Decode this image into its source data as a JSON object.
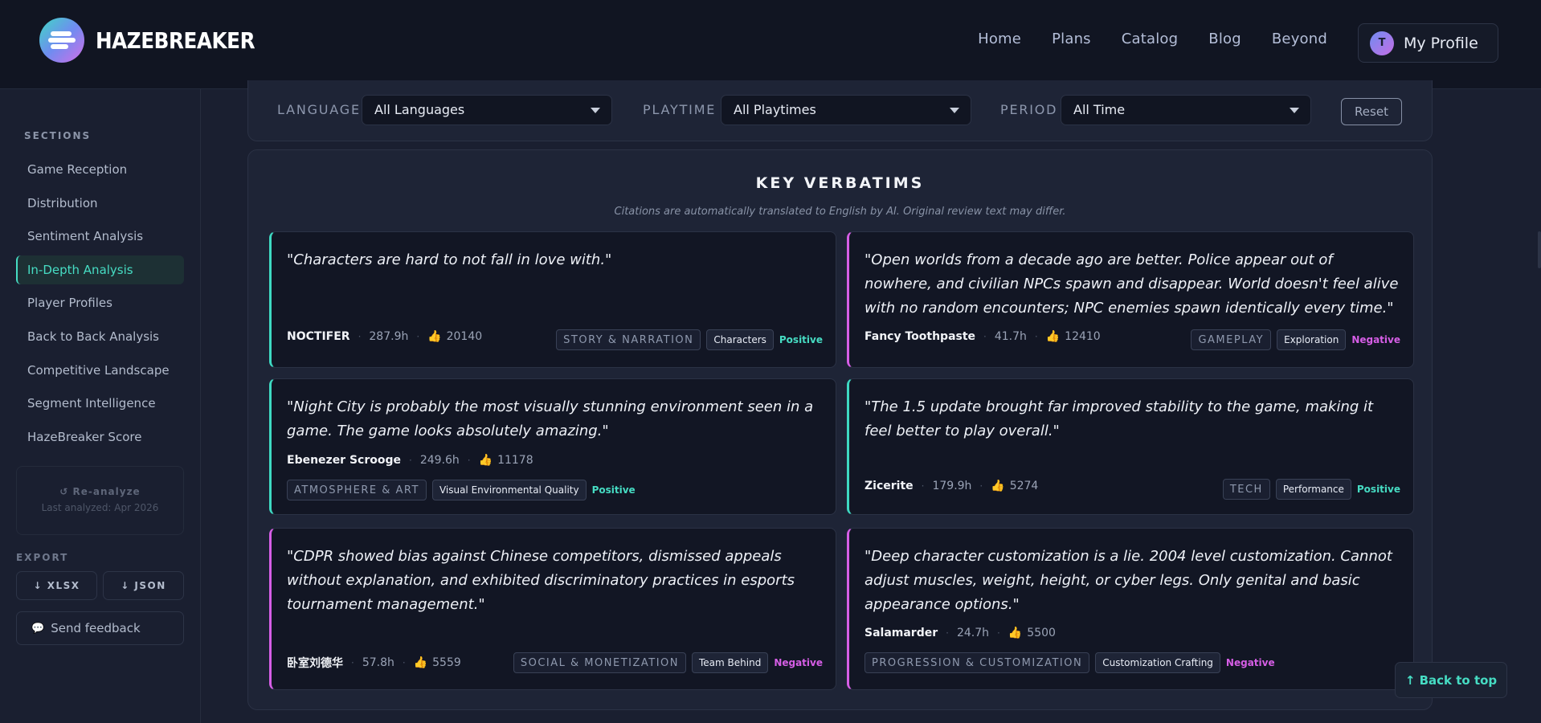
{
  "header": {
    "brand": "HAZEBREAKER",
    "nav": [
      "Home",
      "Plans",
      "Catalog",
      "Blog",
      "Beyond"
    ],
    "profile": {
      "initial": "T",
      "label": "My Profile"
    }
  },
  "sidebar": {
    "sections_title": "SECTIONS",
    "items": [
      {
        "label": "Game Reception",
        "active": false
      },
      {
        "label": "Distribution",
        "active": false
      },
      {
        "label": "Sentiment Analysis",
        "active": false
      },
      {
        "label": "In-Depth Analysis",
        "active": true
      },
      {
        "label": "Player Profiles",
        "active": false
      },
      {
        "label": "Back to Back Analysis",
        "active": false
      },
      {
        "label": "Competitive Landscape",
        "active": false
      },
      {
        "label": "Segment Intelligence",
        "active": false
      },
      {
        "label": "HazeBreaker Score",
        "active": false
      }
    ],
    "reanalyze": {
      "label": "↺ Re-analyze",
      "last": "Last analyzed: Apr 2026"
    },
    "export_title": "EXPORT",
    "export_xlsx": "↓ XLSX",
    "export_json": "↓ JSON",
    "feedback": "Send feedback"
  },
  "filters": {
    "language": {
      "label": "LANGUAGE",
      "value": "All Languages"
    },
    "playtime": {
      "label": "PLAYTIME",
      "value": "All Playtimes"
    },
    "period": {
      "label": "PERIOD",
      "value": "All Time"
    },
    "reset": "Reset"
  },
  "panel": {
    "title": "KEY VERBATIMS",
    "subtitle": "Citations are automatically translated to English by AI. Original review text may differ."
  },
  "cards": [
    {
      "quote": "\"Characters are hard to not fall in love with.\"",
      "author": "NOCTIFER",
      "hours": "287.9h",
      "likes": "20140",
      "category": "STORY & NARRATION",
      "sub": "Characters",
      "sentiment": "Positive"
    },
    {
      "quote": "\"Open worlds from a decade ago are better. Police appear out of nowhere, and civilian NPCs spawn and disappear. World doesn't feel alive with no random encounters; NPC enemies spawn identically every time.\"",
      "author": "Fancy Toothpaste",
      "hours": "41.7h",
      "likes": "12410",
      "category": "GAMEPLAY",
      "sub": "Exploration",
      "sentiment": "Negative"
    },
    {
      "quote": "\"Night City is probably the most visually stunning environment seen in a game. The game looks absolutely amazing.\"",
      "author": "Ebenezer Scrooge",
      "hours": "249.6h",
      "likes": "11178",
      "category": "ATMOSPHERE & ART",
      "sub": "Visual Environmental Quality",
      "sentiment": "Positive"
    },
    {
      "quote": "\"The 1.5 update brought far improved stability to the game, making it feel better to play overall.\"",
      "author": "Zicerite",
      "hours": "179.9h",
      "likes": "5274",
      "category": "TECH",
      "sub": "Performance",
      "sentiment": "Positive"
    },
    {
      "quote": "\"CDPR showed bias against Chinese competitors, dismissed appeals without explanation, and exhibited discriminatory practices in esports tournament management.\"",
      "author": "卧室刘德华",
      "hours": "57.8h",
      "likes": "5559",
      "category": "SOCIAL & MONETIZATION",
      "sub": "Team Behind",
      "sentiment": "Negative"
    },
    {
      "quote": "\"Deep character customization is a lie. 2004 level customization. Cannot adjust muscles, weight, height, or cyber legs. Only genital and basic appearance options.\"",
      "author": "Salamarder",
      "hours": "24.7h",
      "likes": "5500",
      "category": "PROGRESSION & CUSTOMIZATION",
      "sub": "Customization Crafting",
      "sentiment": "Negative"
    }
  ],
  "back_to_top": "↑ Back to top",
  "colors": {
    "positive": "#46dcc3",
    "negative": "#d65ee6",
    "background": "#1a1f30"
  }
}
